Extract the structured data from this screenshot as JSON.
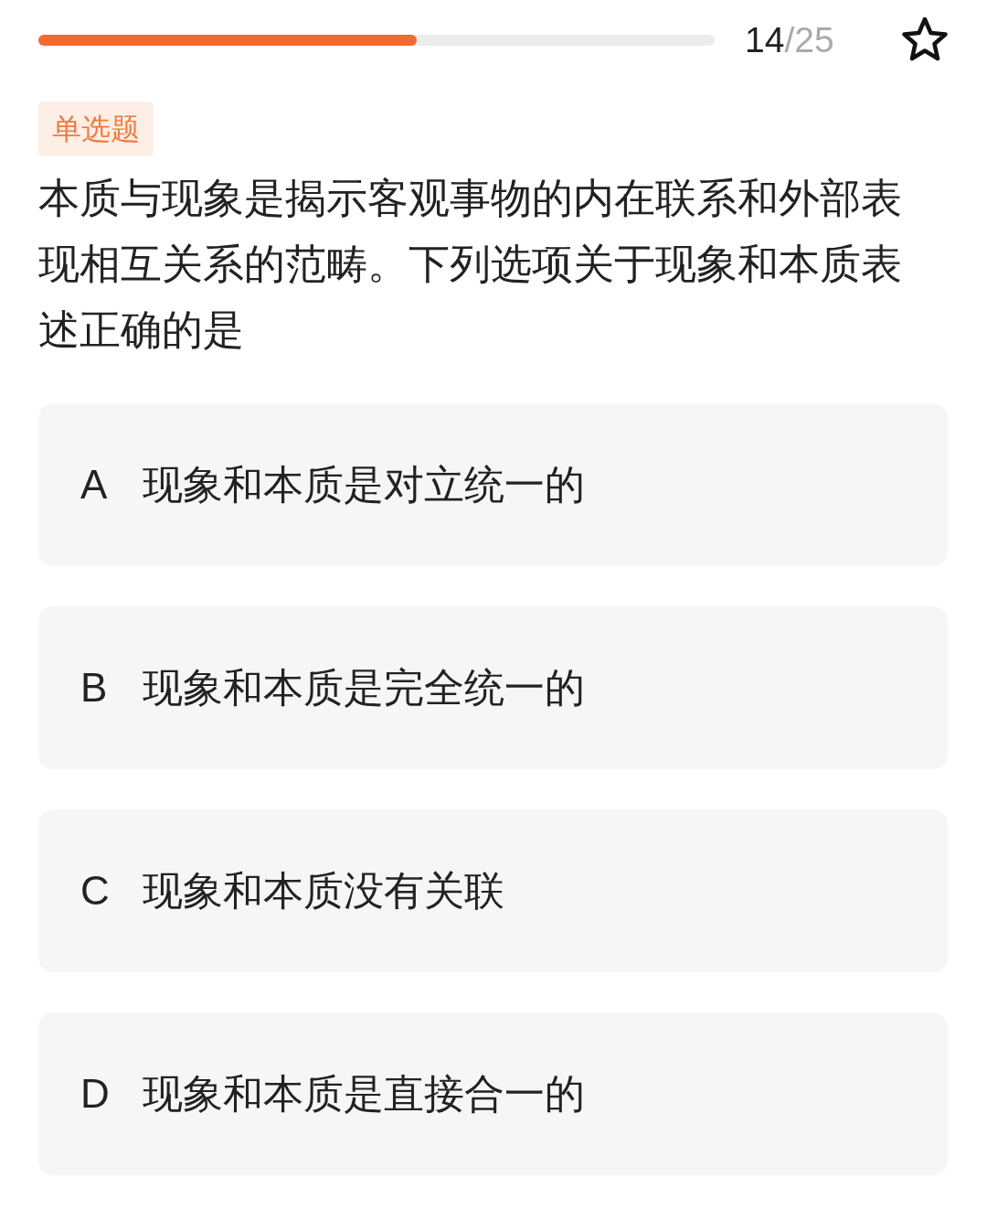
{
  "progress": {
    "level": 0.56,
    "current": "14",
    "total": "/25",
    "starred": false
  },
  "question": {
    "type_tag": "单选题",
    "text": "本质与现象是揭示客观事物的内在联系和外部表现相互关系的范畴。下列选项关于现象和本质表述正确的是"
  },
  "options": [
    {
      "letter": "A",
      "text": "现象和本质是对立统一的"
    },
    {
      "letter": "B",
      "text": "现象和本质是完全统一的"
    },
    {
      "letter": "C",
      "text": "现象和本质没有关联"
    },
    {
      "letter": "D",
      "text": "现象和本质是直接合一的"
    }
  ]
}
